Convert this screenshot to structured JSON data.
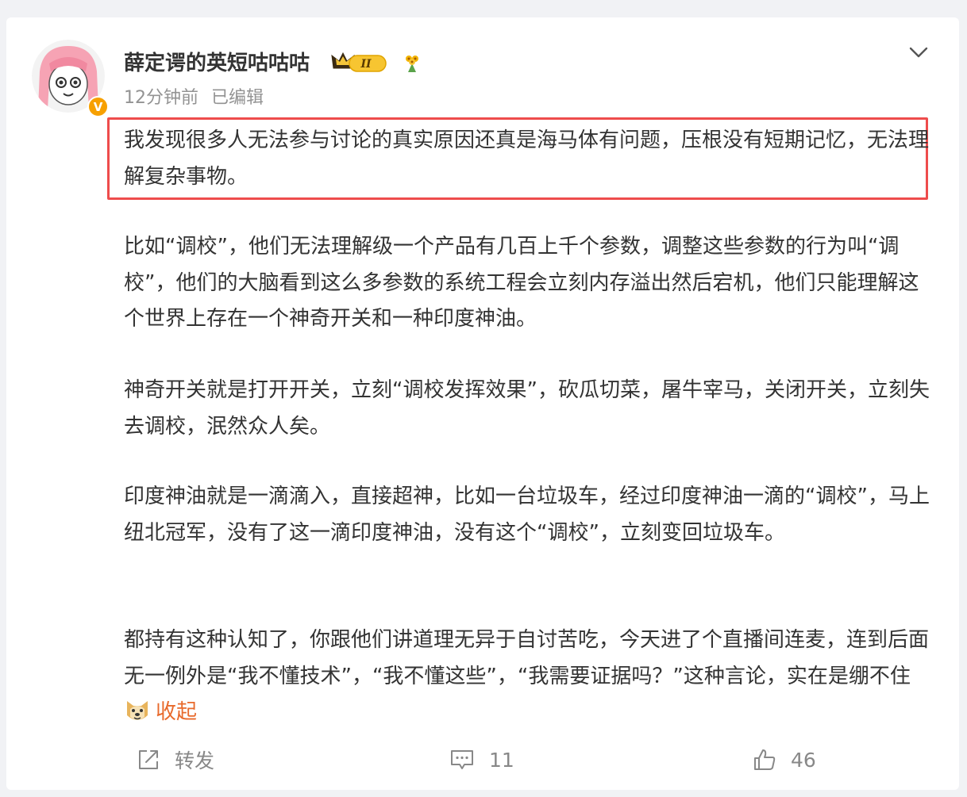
{
  "post": {
    "username": "薛定谔的英短咕咕咕",
    "level_badge": "II",
    "time": "12分钟前",
    "edited": "已编辑",
    "paragraphs": [
      "我发现很多人无法参与讨论的真实原因还真是海马体有问题，压根没有短期记忆，无法理解复杂事物。",
      "比如“调校”，他们无法理解级一个产品有几百上千个参数，调整这些参数的行为叫“调校”，他们的大脑看到这么多参数的系统工程会立刻内存溢出然后宕机，他们只能理解这个世界上存在一个神奇开关和一种印度神油。",
      "神奇开关就是打开开关，立刻“调校发挥效果”，砍瓜切菜，屠牛宰马，关闭开关，立刻失去调校，泯然众人矣。",
      "印度神油就是一滴滴入，直接超神，比如一台垃圾车，经过印度神油一滴的“调校”，马上纽北冠军，没有了这一滴印度神油，没有这个“调校”，立刻变回垃圾车。",
      "都持有这种认知了，你跟他们讲道理无异于自讨苦吃，今天进了个直播间连麦，连到后面无一例外是“我不懂技术”，“我不懂这些”，“我需要证据吗？”这种言论，实在是绷不住"
    ],
    "collapse_label": "收起",
    "share_label": "转发",
    "comment_count": "11",
    "like_count": "46"
  },
  "icons": {
    "expand": "chevron-down-icon",
    "verified": "verified-v-icon",
    "share": "share-icon",
    "comment": "comment-icon",
    "like": "thumbs-up-icon"
  },
  "colors": {
    "highlight_border": "#ee4c4c",
    "collapse_link": "#e86a2c",
    "verified_badge": "#f7a000",
    "meta_text": "#939393"
  }
}
